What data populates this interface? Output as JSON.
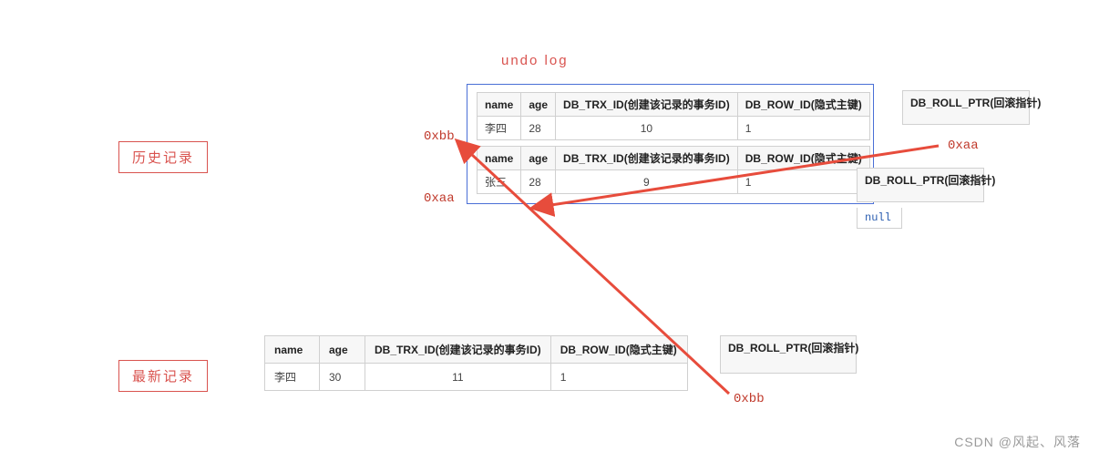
{
  "title": "undo log",
  "sections": {
    "history": "历史记录",
    "latest": "最新记录"
  },
  "headers": {
    "name": "name",
    "age": "age",
    "trx": "DB_TRX_ID(创建该记录的事务ID)",
    "row": "DB_ROW_ID(隐式主键)",
    "roll": "DB_ROLL_PTR(回滚指针)"
  },
  "history": {
    "row1": {
      "ptr_label": "0xbb",
      "name": "李四",
      "age": "28",
      "trx": "10",
      "row": "1",
      "roll": "0xaa"
    },
    "row2": {
      "ptr_label": "0xaa",
      "name": "张三",
      "age": "28",
      "trx": "9",
      "row": "1",
      "roll": "null"
    }
  },
  "latest": {
    "name": "李四",
    "age": "30",
    "trx": "11",
    "row": "1",
    "roll": "0xbb"
  },
  "watermark": "CSDN @风起、风落"
}
